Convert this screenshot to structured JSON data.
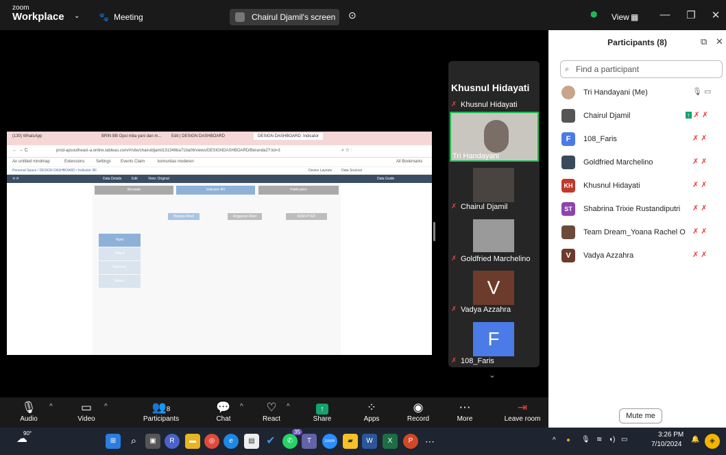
{
  "titlebar": {
    "brand_top": "zoom",
    "brand_bottom": "Workplace",
    "meeting_label": "Meeting",
    "screen_label": "Chairul Djamil's screen",
    "view_label": "View"
  },
  "shared_screen": {
    "tabs": [
      "(130) WhatsApp",
      "BRIN BB Opsi mba yani dan m...",
      "Edit | DESIGN DASHBOARD",
      "DESIGN DASHBOARD: Indicator"
    ],
    "url": "prod-apsoutheast-a.online.tableau.com/#/site/chairuldjamil131346ba71ba06/views/DESIGNDASHBOARD/Beranda2?:iid=3",
    "bookmarks": [
      "An untitled mindmap",
      "Extensions",
      "Settings",
      "Events Claim",
      "komunitas moderen"
    ],
    "all_bookmarks": "All Bookmarks",
    "breadcrumb": "Personal Space / DESIGN DASHBOARD / Indicator IRI",
    "toolbar_items": [
      "Data Details",
      "Edit",
      "View: Original"
    ],
    "toolbar_right": [
      "Data Guide"
    ],
    "crumb_right": [
      "Device Layouts",
      "Data Sources"
    ],
    "nav_buttons": [
      "Beranda",
      "Indicator IRI",
      "Publication"
    ],
    "sub_buttons": [
      "Belanja Riset",
      "Anggaran Riset",
      "SDM IPTEK"
    ],
    "side_menu": [
      "Input",
      "Output",
      "Outcome",
      "Impact"
    ]
  },
  "speaker": {
    "name": "Khusnul Hidayati"
  },
  "tiles": [
    {
      "name": "Khusnul Hidayati"
    },
    {
      "name": "Tri Handayani"
    },
    {
      "name": "Chairul Djamil"
    },
    {
      "name": "Goldfried Marchelino"
    },
    {
      "name": "Vadya Azzahra",
      "initial": "V"
    },
    {
      "name": "108_Faris",
      "initial": "F"
    }
  ],
  "participants_panel": {
    "title": "Participants (8)",
    "search_placeholder": "Find a participant",
    "mute_me": "Mute me",
    "people": [
      {
        "name": "Tri Handayani (Me)",
        "avatar": "photo"
      },
      {
        "name": "Chairul Djamil",
        "avatar": "photo"
      },
      {
        "name": "108_Faris",
        "avatar": "F",
        "color": "#4a7be6"
      },
      {
        "name": "Goldfried Marchelino",
        "avatar": "photo"
      },
      {
        "name": "Khusnul Hidayati",
        "avatar": "KH",
        "color": "#c0392b"
      },
      {
        "name": "Shabrina Trixie Rustandiputri",
        "avatar": "ST",
        "color": "#8e44ad"
      },
      {
        "name": "Team Dream_Yoana Rachel O",
        "avatar": "photo"
      },
      {
        "name": "Vadya Azzahra",
        "avatar": "V",
        "color": "#6d3b2c"
      }
    ]
  },
  "toolbar": {
    "audio": "Audio",
    "video": "Video",
    "participants": "Participants",
    "participants_count": "8",
    "chat": "Chat",
    "react": "React",
    "share": "Share",
    "apps": "Apps",
    "record": "Record",
    "more": "More",
    "leave": "Leave room"
  },
  "taskbar": {
    "weather": "90°",
    "time": "3:26 PM",
    "date": "7/10/2024",
    "badge": "35"
  },
  "colors": {
    "accent_green": "#1db954",
    "mute_red": "#e04040",
    "share_green": "#13a36e"
  }
}
